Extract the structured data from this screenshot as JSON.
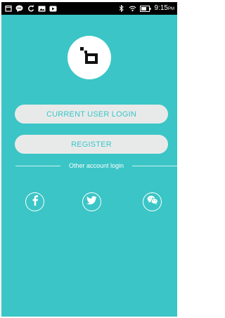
{
  "status_bar": {
    "time": "9:15",
    "meridiem": "PM",
    "left_icons": [
      "calendar-icon",
      "chat-icon",
      "sync-icon",
      "image-icon",
      "video-icon"
    ],
    "right_icons": [
      "bluetooth-icon",
      "wifi-icon",
      "battery-icon"
    ]
  },
  "logo": {
    "icon": "app-logo-icon"
  },
  "actions": {
    "login_label": "CURRENT USER LOGIN",
    "register_label": "REGISTER"
  },
  "other_login": {
    "label": "Other account login",
    "providers": [
      "facebook-icon",
      "twitter-icon",
      "wechat-icon"
    ]
  },
  "colors": {
    "background": "#3bc5c6",
    "button": "#e8eaea",
    "button_text": "#3bc5c6",
    "status_bar": "#000000"
  }
}
